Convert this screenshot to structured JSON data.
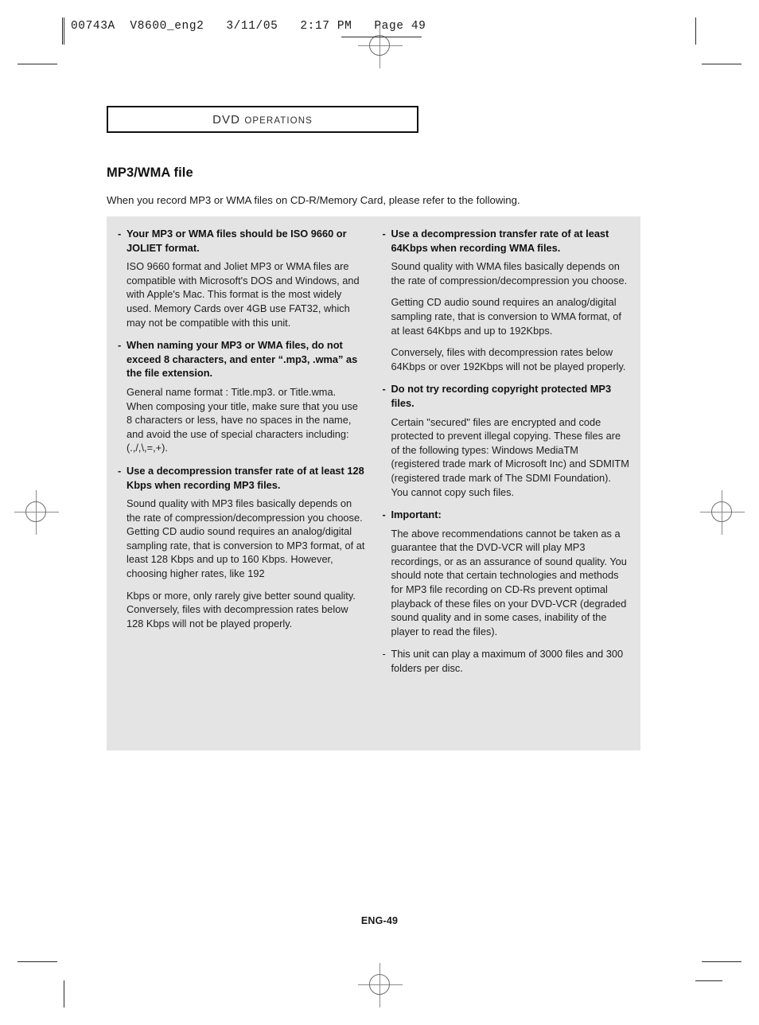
{
  "production_header": {
    "text": "00743A  V8600_eng2   3/11/05   2:17 PM   Page 49"
  },
  "section_box": {
    "title_main": "DVD",
    "title_rest": "OPERATIONS"
  },
  "page": {
    "title": "MP3/WMA file",
    "intro": "When you record MP3 or WMA files on CD-R/Memory Card, please refer to the following.",
    "footer": "ENG-49"
  },
  "panel": {
    "left_column": {
      "blocks": [
        {
          "dash": "-",
          "heading": "Your MP3 or WMA files should be ISO 9660 or JOLIET format.",
          "body": "ISO 9660 format and Joliet MP3 or WMA files are compatible with Microsoft's DOS and Windows, and with Apple's Mac. This format is the most widely used. Memory Cards over 4GB use FAT32, which may not be compatible with this unit."
        },
        {
          "dash": "-",
          "heading": "When naming your MP3 or WMA files, do not exceed 8 characters, and enter “.mp3, .wma” as the file extension.",
          "body": "General name format : Title.mp3. or Title.wma. When composing your title, make sure that you use 8 characters or less, have no spaces in the name, and avoid the use of special characters including: (.,/,\\,=,+)."
        },
        {
          "dash": "-",
          "heading": "Use a decompression transfer rate of at least 128 Kbps when recording MP3 files.",
          "body": "Sound quality with MP3 files basically depends on the rate of compression/decompression you choose. Getting CD audio sound requires an analog/digital sampling rate, that is conversion to MP3 format, of at least 128 Kbps and up to 160 Kbps. However, choosing higher rates, like 192",
          "body2": "Kbps or more, only rarely give better sound quality. Conversely, files with decompression rates below 128 Kbps will not be played properly."
        }
      ]
    },
    "right_column": {
      "blocks": [
        {
          "dash": "-",
          "heading": "Use a decompression transfer rate of at least 64Kbps when recording WMA files.",
          "body": "Sound quality with WMA files basically depends on the rate of compression/decompression you choose.",
          "body2": "Getting CD audio sound requires an analog/digital sampling rate, that is conversion to WMA format, of at least 64Kbps and up to 192Kbps.",
          "body3": "Conversely, files with decompression rates below 64Kbps or over 192Kbps will not be played properly."
        },
        {
          "dash": "-",
          "heading": "Do not try recording copyright protected MP3 files.",
          "body": "Certain \"secured\" files are encrypted and code protected to prevent illegal copying. These files are of the following types: Windows MediaTM (registered trade mark of Microsoft Inc) and SDMITM (registered trade mark of The SDMI Foundation). You cannot copy such files."
        },
        {
          "dash": "-",
          "heading": "Important:",
          "body": "The above recommendations cannot be taken as a guarantee that the DVD-VCR will play MP3 recordings, or as an assurance of sound quality. You should note that certain technologies and methods for MP3 file recording on CD-Rs prevent optimal playback of these files on your DVD-VCR (degraded sound quality and in some cases, inability of the player to read the files)."
        },
        {
          "dash": "-",
          "plain": "This unit can play a maximum of 3000 files and 300 folders per disc."
        }
      ]
    }
  }
}
